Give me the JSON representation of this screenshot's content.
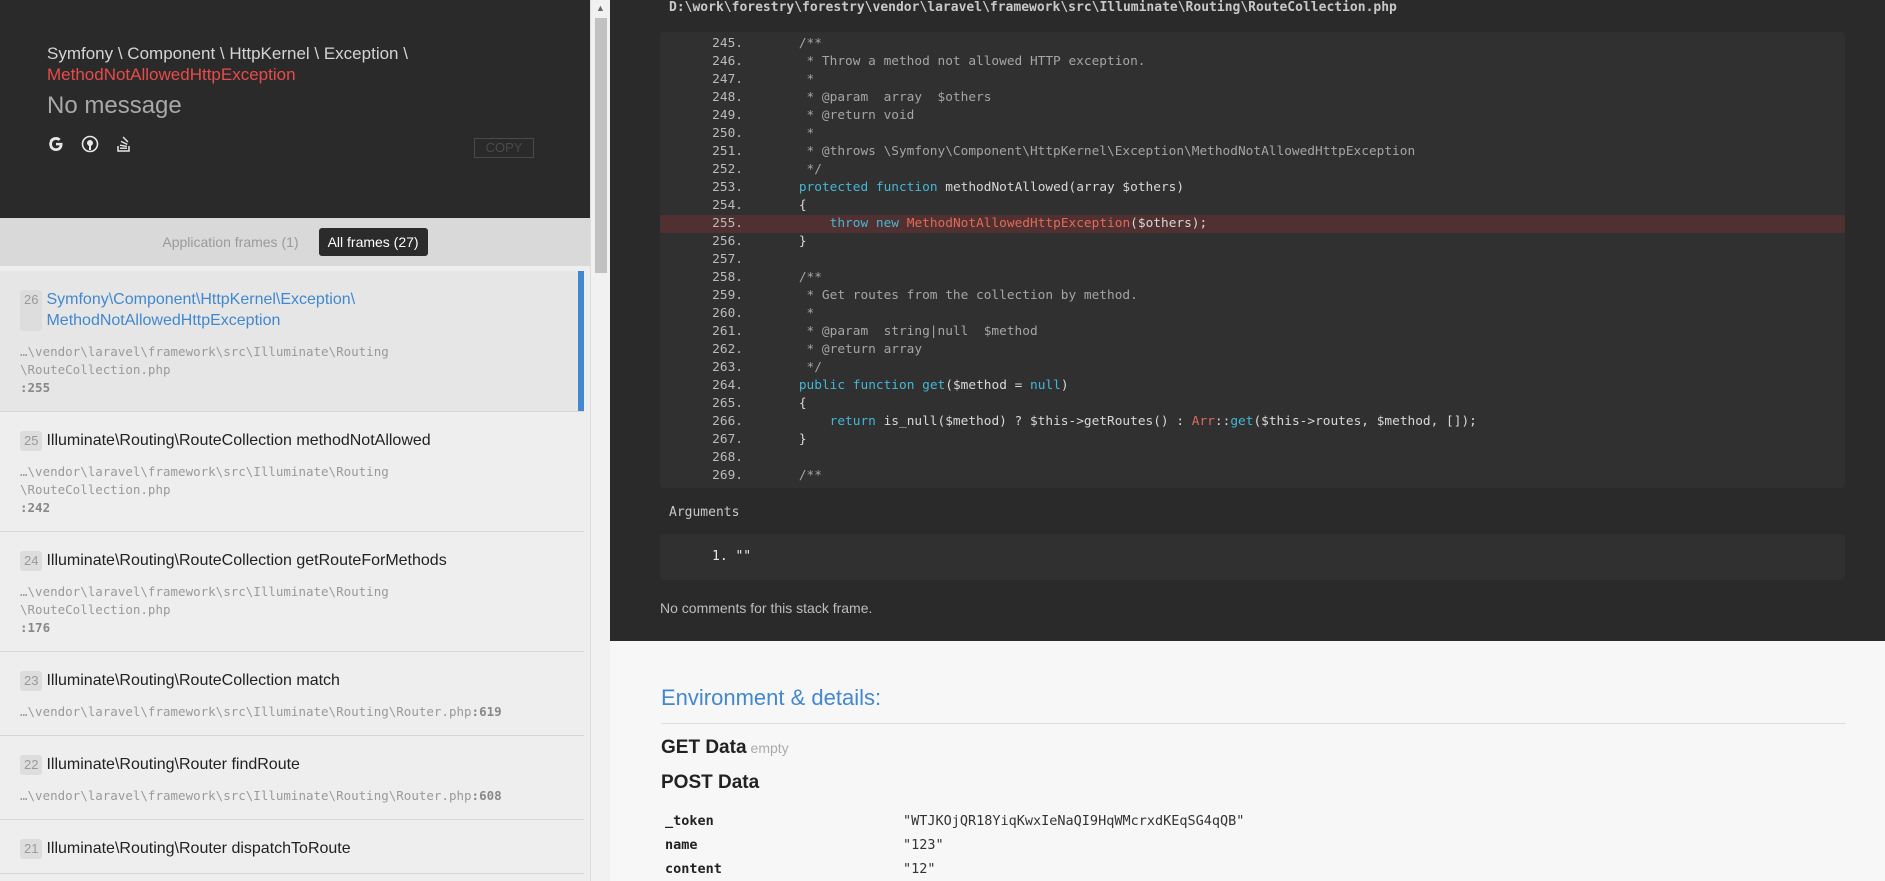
{
  "exception": {
    "namespace": "Symfony \\ Component \\ HttpKernel \\ Exception \\",
    "class_name": "MethodNotAllowedHttpException",
    "message": "No message",
    "copy_label": "COPY",
    "search_icons": [
      "google-icon",
      "duckduckgo-icon",
      "stackoverflow-icon"
    ]
  },
  "frame_filter": {
    "app_label": "Application frames (1)",
    "all_label": "All frames (27)"
  },
  "frames": [
    {
      "index": "26",
      "title_line1": "Symfony\\Component\\HttpKernel\\Exception\\",
      "title_line2": "MethodNotAllowedHttpException",
      "file_line1": "…\\vendor\\laravel\\framework\\src\\Illuminate\\Routing",
      "file_line2": "\\RouteCollection.php",
      "line": ":255"
    },
    {
      "index": "25",
      "title_line1": "Illuminate\\Routing\\RouteCollection methodNotAllowed",
      "file_line1": "…\\vendor\\laravel\\framework\\src\\Illuminate\\Routing",
      "file_line2": "\\RouteCollection.php",
      "line": ":242"
    },
    {
      "index": "24",
      "title_line1": "Illuminate\\Routing\\RouteCollection getRouteForMethods",
      "file_line1": "…\\vendor\\laravel\\framework\\src\\Illuminate\\Routing",
      "file_line2": "\\RouteCollection.php",
      "line": ":176"
    },
    {
      "index": "23",
      "title_line1": "Illuminate\\Routing\\RouteCollection match",
      "file_line1": "…\\vendor\\laravel\\framework\\src\\Illuminate\\Routing\\Router.php",
      "line": ":619"
    },
    {
      "index": "22",
      "title_line1": "Illuminate\\Routing\\Router findRoute",
      "file_line1": "…\\vendor\\laravel\\framework\\src\\Illuminate\\Routing\\Router.php",
      "line": ":608"
    },
    {
      "index": "21",
      "title_line1": "Illuminate\\Routing\\Router dispatchToRoute"
    }
  ],
  "code": {
    "file_path": "D:\\work\\forestry\\forestry\\vendor\\laravel\\framework\\src\\Illuminate\\Routing\\RouteCollection.php",
    "highlight_line": "255.",
    "lines": [
      {
        "n": "245.",
        "t": "    /**"
      },
      {
        "n": "246.",
        "t": "     * Throw a method not allowed HTTP exception."
      },
      {
        "n": "247.",
        "t": "     *"
      },
      {
        "n": "248.",
        "t": "     * @param  array  $others"
      },
      {
        "n": "249.",
        "t": "     * @return void"
      },
      {
        "n": "250.",
        "t": "     *"
      },
      {
        "n": "251.",
        "t": "     * @throws \\Symfony\\Component\\HttpKernel\\Exception\\MethodNotAllowedHttpException"
      },
      {
        "n": "252.",
        "t": "     */"
      },
      {
        "n": "253.",
        "t": "    protected function methodNotAllowed(array $others)"
      },
      {
        "n": "254.",
        "t": "    {"
      },
      {
        "n": "255.",
        "t": "        throw new MethodNotAllowedHttpException($others);"
      },
      {
        "n": "256.",
        "t": "    }"
      },
      {
        "n": "257.",
        "t": ""
      },
      {
        "n": "258.",
        "t": "    /**"
      },
      {
        "n": "259.",
        "t": "     * Get routes from the collection by method."
      },
      {
        "n": "260.",
        "t": "     *"
      },
      {
        "n": "261.",
        "t": "     * @param  string|null  $method"
      },
      {
        "n": "262.",
        "t": "     * @return array"
      },
      {
        "n": "263.",
        "t": "     */"
      },
      {
        "n": "264.",
        "t": "    public function get($method = null)"
      },
      {
        "n": "265.",
        "t": "    {"
      },
      {
        "n": "266.",
        "t": "        return is_null($method) ? $this->getRoutes() : Arr::get($this->routes, $method, []);"
      },
      {
        "n": "267.",
        "t": "    }"
      },
      {
        "n": "268.",
        "t": ""
      },
      {
        "n": "269.",
        "t": "    /**"
      }
    ]
  },
  "arguments": {
    "label": "Arguments",
    "items": [
      "1. \"\""
    ]
  },
  "comments_text": "No comments for this stack frame.",
  "details": {
    "title": "Environment & details:",
    "get_title": "GET Data",
    "get_empty": "empty",
    "post_title": "POST Data",
    "post_rows": [
      {
        "key": "_token",
        "value": "\"WTJKOjQR18YiqKwxIeNaQI9HqWMcrxdKEqSG4qQB\""
      },
      {
        "key": "name",
        "value": "\"123\""
      },
      {
        "key": "content",
        "value": "\"12\""
      }
    ]
  },
  "colors": {
    "accent": "#4288ce",
    "exception_red": "#e94b4b",
    "highlight_row": "#503030"
  }
}
